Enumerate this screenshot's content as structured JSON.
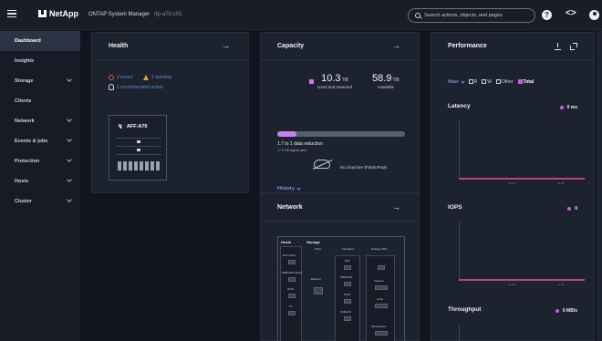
{
  "app": {
    "brand": "NetApp",
    "title": "ONTAP System Manager",
    "cluster": "rtp-a70-c01"
  },
  "search": {
    "placeholder": "Search actions, objects, and pages"
  },
  "icons": {
    "menu": "hamburger-icon",
    "help": "help-icon",
    "code": "code-icon",
    "user": "user-icon"
  },
  "sidebar": {
    "items": [
      {
        "label": "Dashboard",
        "active": true,
        "expandable": false
      },
      {
        "label": "Insights",
        "active": false,
        "expandable": false
      },
      {
        "label": "Storage",
        "active": false,
        "expandable": true
      },
      {
        "label": "Clients",
        "active": false,
        "expandable": false
      },
      {
        "label": "Network",
        "active": false,
        "expandable": true
      },
      {
        "label": "Events & jobs",
        "active": false,
        "expandable": true
      },
      {
        "label": "Protection",
        "active": false,
        "expandable": true
      },
      {
        "label": "Hosts",
        "active": false,
        "expandable": true
      },
      {
        "label": "Cluster",
        "active": false,
        "expandable": true
      }
    ]
  },
  "health": {
    "title": "Health",
    "errors": "2 errors",
    "warnings": "1 warning",
    "recommended": "1 recommended action",
    "node": "AFF-A70"
  },
  "capacity": {
    "title": "Capacity",
    "used_value": "10.3",
    "used_unit": "TiB",
    "used_label": "Used and reserved",
    "available_value": "58.9",
    "available_unit": "TiB",
    "available_label": "Available",
    "used_fraction": 0.15,
    "reduction": "1.7 to 1 data reduction",
    "reduction_detail": "17.5 TiB logical used",
    "cloud_tier": "No cloud tier (FabricPool)",
    "history": "History"
  },
  "network": {
    "title": "Network",
    "hosts": "Hosts",
    "storage": "Storage",
    "ports_label": "Ports",
    "interfaces_label": "Interfaces",
    "storage_vms_label": "Storage VMs",
    "ethernet": "Ethernet",
    "host_rows": [
      "NFS clients",
      "SMB/CIFS clients",
      "iSCSI",
      "FC"
    ],
    "interface_rows": [
      "NFS",
      "SMB/CIFS",
      "iSCSI",
      "NVMe/FC"
    ],
    "svm_rows": [
      "Volumes",
      "LUNs",
      "Namespaces"
    ]
  },
  "performance": {
    "title": "Performance",
    "range": "Hour",
    "filters": [
      {
        "label": "R",
        "checked": false
      },
      {
        "label": "W",
        "checked": false
      },
      {
        "label": "Other",
        "checked": false
      },
      {
        "label": "Total",
        "checked": true
      }
    ],
    "latency": {
      "label": "Latency",
      "value": "0 ms"
    },
    "iops": {
      "label": "IOPS",
      "value": "0"
    },
    "throughput": {
      "label": "Throughput",
      "value": "0 MB/s"
    },
    "ticks": [
      "10:30",
      "11:00"
    ],
    "accent": "#c95fe0"
  },
  "colors": {
    "accent": "#c95fe0",
    "link": "#7d95e0",
    "error": "#e0584f",
    "warning": "#e3a13a"
  }
}
